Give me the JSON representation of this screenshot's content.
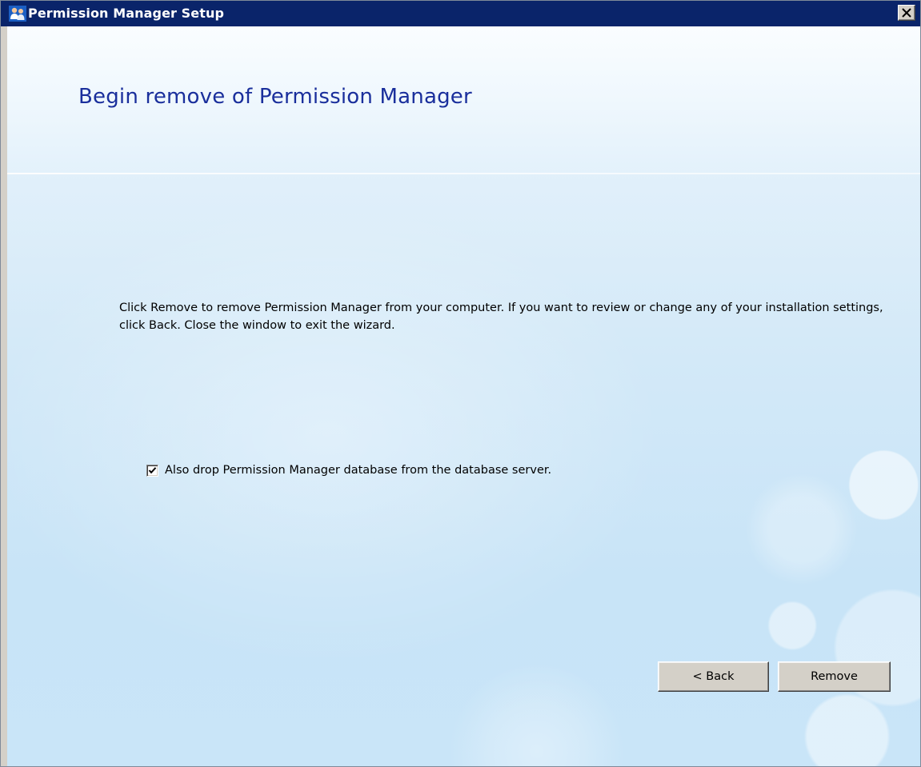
{
  "window": {
    "title": "Permission Manager Setup",
    "icon": "people-icon",
    "close_icon": "close-icon"
  },
  "header": {
    "title": "Begin remove of Permission Manager"
  },
  "body": {
    "instructions": "Click Remove to remove Permission Manager from your computer.  If you want to review or change any of your installation settings, click Back.  Close the window to exit the wizard."
  },
  "options": {
    "drop_database": {
      "label": "Also drop Permission Manager database from the database server.",
      "checked": true
    }
  },
  "buttons": {
    "back_label": "< Back",
    "remove_label": "Remove"
  },
  "colors": {
    "titlebar": "#0a246a",
    "heading": "#1a2f9c",
    "background_top": "#eef6fc",
    "background_bottom": "#c9e5f8",
    "button_face": "#d4d0c8"
  }
}
